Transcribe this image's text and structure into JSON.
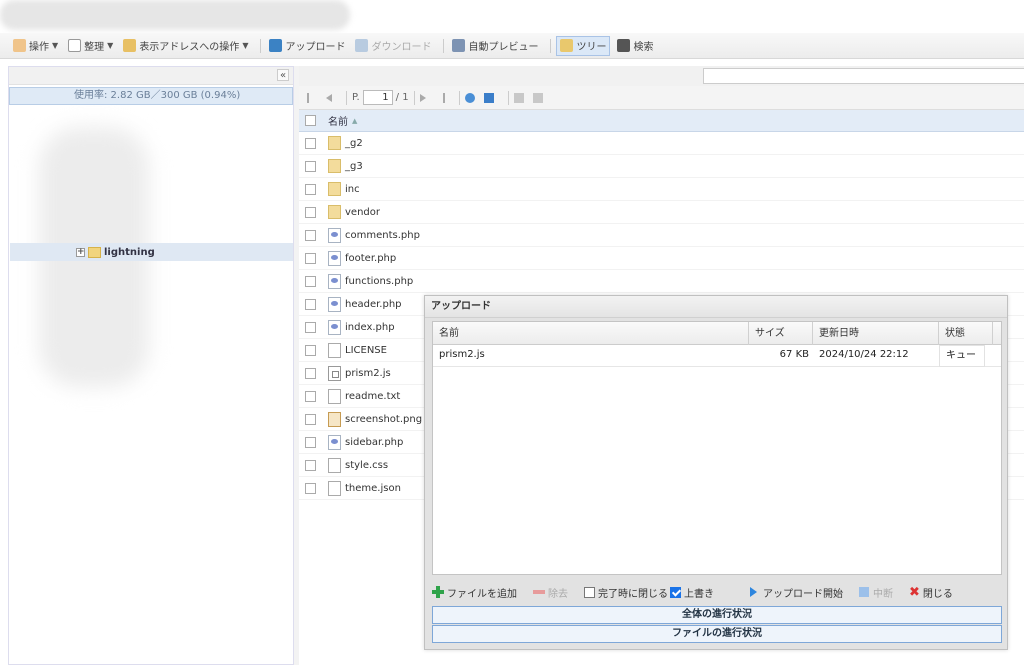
{
  "toolbar": {
    "items": [
      {
        "label": "操作",
        "icon": "hand-icon",
        "dropdown": true
      },
      {
        "label": "整理",
        "icon": "document-icon",
        "dropdown": true
      },
      {
        "label": "表示アドレスへの操作",
        "icon": "address-icon",
        "dropdown": true
      },
      {
        "label": "アップロード",
        "icon": "upload-icon"
      },
      {
        "label": "ダウンロード",
        "icon": "download-icon",
        "disabled": true
      },
      {
        "label": "自動プレビュー",
        "icon": "preview-icon"
      },
      {
        "label": "ツリー",
        "icon": "tree-icon",
        "active": true
      },
      {
        "label": "検索",
        "icon": "binoculars-icon"
      }
    ]
  },
  "sidebar": {
    "usage": "使用率: 2.82 GB／300 GB (0.94%)",
    "tree_item": "lightning"
  },
  "pager": {
    "page_prefix": "P.",
    "page_value": "1",
    "page_total": "/ 1"
  },
  "filelist": {
    "header": "名前",
    "files": [
      {
        "name": "_g2",
        "type": "folder"
      },
      {
        "name": "_g3",
        "type": "folder"
      },
      {
        "name": "inc",
        "type": "folder"
      },
      {
        "name": "vendor",
        "type": "folder"
      },
      {
        "name": "comments.php",
        "type": "php"
      },
      {
        "name": "footer.php",
        "type": "php"
      },
      {
        "name": "functions.php",
        "type": "php"
      },
      {
        "name": "header.php",
        "type": "php"
      },
      {
        "name": "index.php",
        "type": "php"
      },
      {
        "name": "LICENSE",
        "type": "doc"
      },
      {
        "name": "prism2.js",
        "type": "js"
      },
      {
        "name": "readme.txt",
        "type": "doc"
      },
      {
        "name": "screenshot.png",
        "type": "img"
      },
      {
        "name": "sidebar.php",
        "type": "php"
      },
      {
        "name": "style.css",
        "type": "doc"
      },
      {
        "name": "theme.json",
        "type": "doc"
      }
    ]
  },
  "upload_dialog": {
    "title": "アップロード",
    "columns": [
      "名前",
      "サイズ",
      "更新日時",
      "状態"
    ],
    "rows": [
      {
        "name": "prism2.js",
        "size": "67 KB",
        "date": "2024/10/24 22:12",
        "state": "キュー"
      }
    ],
    "buttons": {
      "add": "ファイルを追加",
      "remove": "除去",
      "close_on_done": "完了時に閉じる",
      "overwrite": "上書き",
      "start": "アップロード開始",
      "cancel": "中断",
      "close": "閉じる"
    },
    "close_on_done_checked": false,
    "overwrite_checked": true,
    "progress_total": "全体の進行状況",
    "progress_file": "ファイルの進行状況"
  }
}
